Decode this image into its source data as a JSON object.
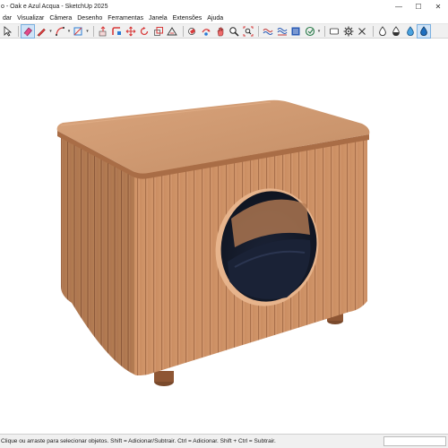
{
  "app": {
    "title": "o - Oak e Azul Acqua - SketchUp 2025"
  },
  "window_controls": {
    "minimize": "—",
    "maximize": "☐",
    "close": "✕"
  },
  "menu": {
    "items": [
      "dar",
      "Visualizar",
      "Câmera",
      "Desenho",
      "Ferramentas",
      "Janela",
      "Extensões",
      "Ajuda"
    ]
  },
  "toolbar": {
    "tools": [
      {
        "icon": "select-arrow-icon"
      },
      {
        "icon": "eraser-icon",
        "active": true
      },
      {
        "icon": "pencil-line-icon",
        "dropdown": true
      },
      {
        "icon": "arc-icon",
        "dropdown": true
      },
      {
        "icon": "rectangle-icon",
        "dropdown": true
      },
      {
        "icon": "push-pull-icon"
      },
      {
        "icon": "follow-me-icon"
      },
      {
        "icon": "move-icon"
      },
      {
        "icon": "rotate-icon"
      },
      {
        "icon": "scale-icon"
      },
      {
        "icon": "tape-measure-icon"
      },
      {
        "icon": "paint-bucket-icon"
      },
      {
        "icon": "orbit-icon"
      },
      {
        "icon": "pan-icon"
      },
      {
        "icon": "zoom-icon"
      },
      {
        "icon": "zoom-extents-icon"
      },
      {
        "icon": "warehouse-icon"
      },
      {
        "icon": "extension-warehouse-icon"
      },
      {
        "icon": "layout-icon"
      },
      {
        "icon": "extension-manager-icon",
        "dropdown": true
      },
      {
        "icon": "section-plane-icon"
      },
      {
        "icon": "gear-icon"
      },
      {
        "icon": "close-x-icon"
      },
      {
        "icon": "drop-outline-icon"
      },
      {
        "icon": "drop-half-icon"
      },
      {
        "icon": "drop-blue-icon"
      },
      {
        "icon": "drop-active-icon",
        "active": true
      }
    ]
  },
  "status": {
    "text": "Clique ou arraste para selecionar objetos. Shift = Adicionar/Subtrair. Ctrl = Adicionar. Shift + Ctrl = Subtrair."
  },
  "colors": {
    "wood_top": "#c8926a",
    "wood_front": "#c98a5e",
    "wood_side": "#b07048",
    "hole": "#1e2535",
    "accent": "#2a7bd5"
  }
}
